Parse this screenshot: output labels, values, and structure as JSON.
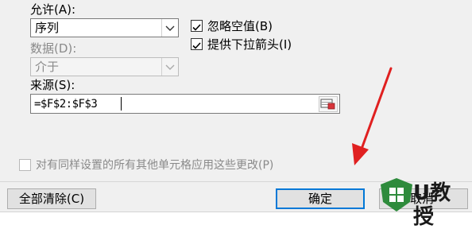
{
  "allow": {
    "label": "允许(A):",
    "value": "序列"
  },
  "data": {
    "label": "数据(D):",
    "value": "介于"
  },
  "source": {
    "label": "来源(S):",
    "value": "=$F$2:$F$3"
  },
  "options": {
    "ignore_blank": {
      "label": "忽略空值(B)",
      "checked": true
    },
    "dropdown": {
      "label": "提供下拉箭头(I)",
      "checked": true
    }
  },
  "apply_all": {
    "label": "对有同样设置的所有其他单元格应用这些更改(P)",
    "checked": false
  },
  "buttons": {
    "clear_all": "全部清除(C)",
    "ok": "确定",
    "cancel": "取消"
  },
  "watermark": {
    "text": "U教授"
  },
  "colors": {
    "dialog_bg": "#f0f0f0",
    "default_button_border": "#0078d7",
    "arrow": "#e02020",
    "logo_green": "#2e8b3c"
  }
}
